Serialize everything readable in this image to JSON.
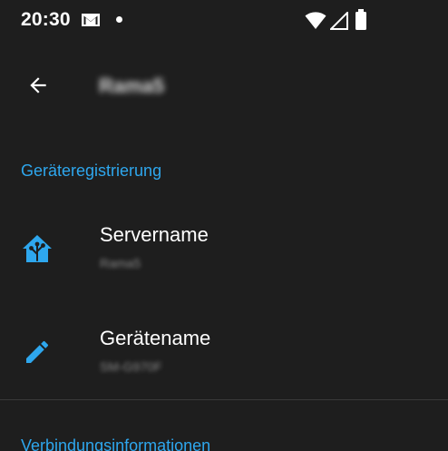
{
  "status_bar": {
    "time": "20:30",
    "icons": [
      "gmail-icon",
      "notification-dot",
      "wifi-icon",
      "signal-icon",
      "battery-icon"
    ]
  },
  "app_bar": {
    "title": "Rama5",
    "back_icon": "arrow-back-icon"
  },
  "sections": [
    {
      "header": "Geräteregistrierung",
      "items": [
        {
          "icon": "home-assistant-icon",
          "title": "Servername",
          "subtitle": "Rama5"
        },
        {
          "icon": "pencil-icon",
          "title": "Gerätename",
          "subtitle": "SM-G970F"
        }
      ]
    },
    {
      "header": "Verbindungsinformationen"
    }
  ],
  "colors": {
    "background": "#1e1e1e",
    "accent": "#2ea7ee",
    "text_primary": "#ffffff",
    "text_secondary": "#8a8a8a",
    "divider": "#3a3a3a"
  }
}
